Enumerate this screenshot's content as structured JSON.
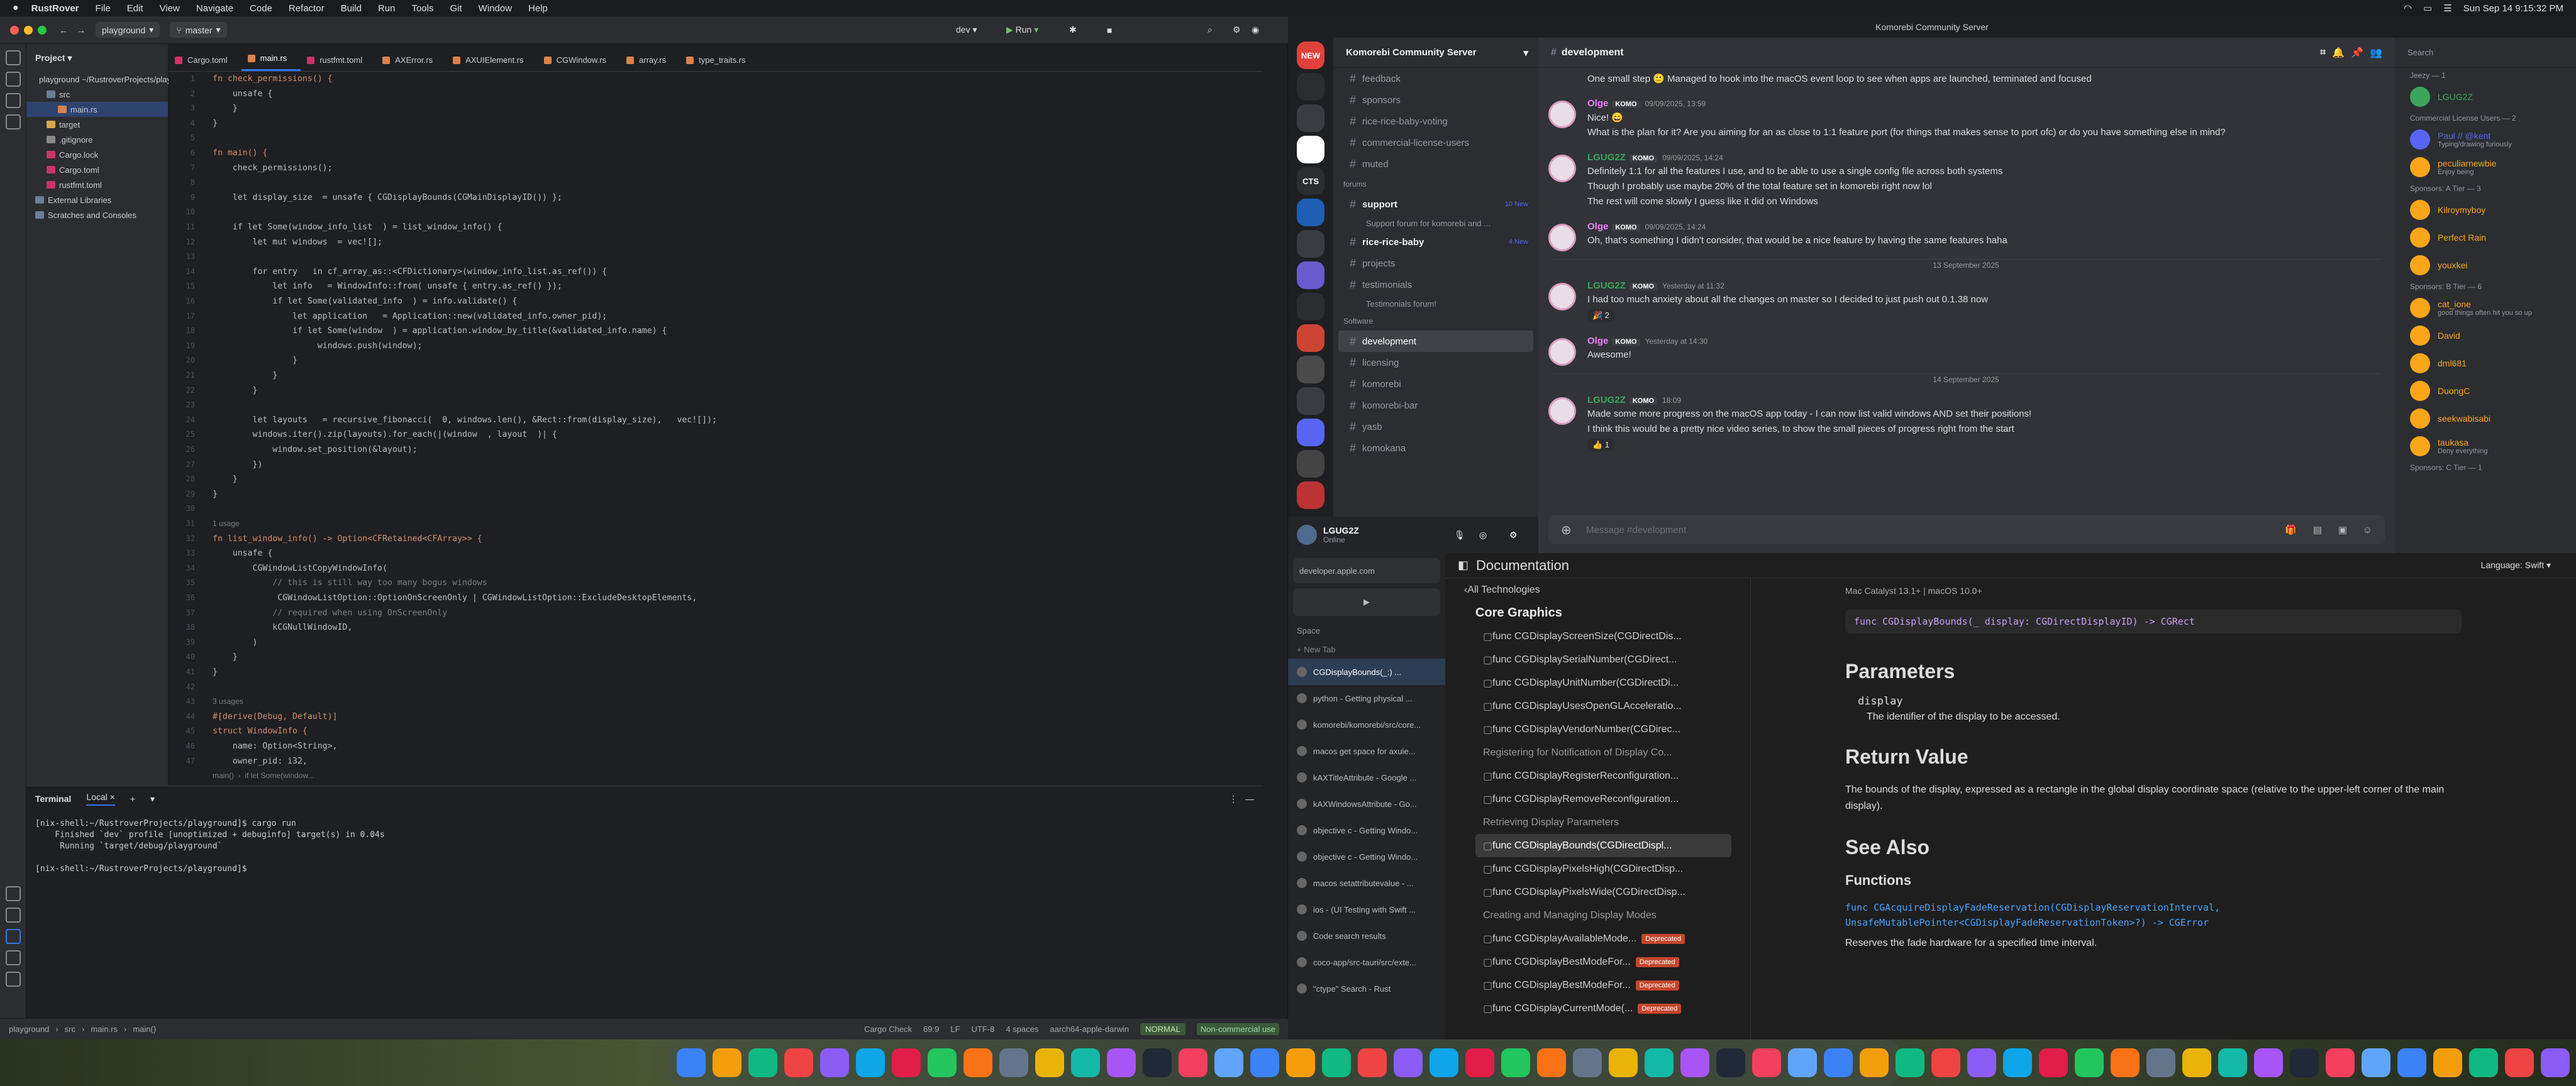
{
  "menubar": {
    "apple": "",
    "app_name": "RustRover",
    "items": [
      "File",
      "Edit",
      "View",
      "Navigate",
      "Code",
      "Refactor",
      "Build",
      "Run",
      "Tools",
      "Git",
      "Window",
      "Help"
    ],
    "clock": "Sun Sep 14  9:15:32 PM"
  },
  "ide": {
    "project_chip": "playground",
    "branch_chip": "master",
    "run_config": "dev",
    "run_label": "Run",
    "project_title": "Project",
    "tree": [
      {
        "label": "playground ~/RustroverProjects/playground",
        "indent": 0,
        "color": "#6b7d9a"
      },
      {
        "label": "src",
        "indent": 1,
        "color": "#6b7d9a"
      },
      {
        "label": "main.rs",
        "indent": 2,
        "color": "#d9824b",
        "selected": true
      },
      {
        "label": "target",
        "indent": 1,
        "color": "#d9a64b"
      },
      {
        "label": ".gitignore",
        "indent": 1,
        "color": "#888"
      },
      {
        "label": "Cargo.lock",
        "indent": 1,
        "color": "#c36"
      },
      {
        "label": "Cargo.toml",
        "indent": 1,
        "color": "#c36"
      },
      {
        "label": "rustfmt.toml",
        "indent": 1,
        "color": "#c36"
      },
      {
        "label": "External Libraries",
        "indent": 0,
        "color": "#6b7d9a"
      },
      {
        "label": "Scratches and Consoles",
        "indent": 0,
        "color": "#6b7d9a"
      }
    ],
    "tabs": [
      {
        "label": "Cargo.toml",
        "color": "#c36"
      },
      {
        "label": "main.rs",
        "color": "#d9824b",
        "active": true
      },
      {
        "label": "rustfmt.toml",
        "color": "#c36"
      },
      {
        "label": "AXError.rs",
        "color": "#d9824b"
      },
      {
        "label": "AXUIElement.rs",
        "color": "#d9824b"
      },
      {
        "label": "CGWindow.rs",
        "color": "#d9824b"
      },
      {
        "label": "array.rs",
        "color": "#d9824b"
      },
      {
        "label": "type_traits.rs",
        "color": "#d9824b"
      }
    ],
    "code_lines": [
      "fn check_permissions() {",
      "    unsafe {",
      "    }",
      "}",
      "",
      "fn main() {",
      "    check_permissions();",
      "",
      "    let display_size  = unsafe { CGDisplayBounds(CGMainDisplayID()) };",
      "",
      "    if let Some(window_info_list  ) = list_window_info() {",
      "        let mut windows  = vec![];",
      "",
      "        for entry   in cf_array_as::<CFDictionary>(window_info_list.as_ref()) {",
      "            let info   = WindowInfo::from( unsafe { entry.as_ref() });",
      "            if let Some(validated_info  ) = info.validate() {",
      "                let application   = Application::new(validated_info.owner_pid);",
      "                if let Some(window  ) = application.window_by_title(&validated_info.name) {",
      "                     windows.push(window);",
      "                }",
      "            }",
      "        }",
      "",
      "        let layouts   = recursive_fibonacci(  0, windows.len(), &Rect::from(display_size),   vec![]);",
      "        windows.iter().zip(layouts).for_each(|(window  , layout  )| {",
      "            window.set_position(&layout);",
      "        })",
      "    }",
      "}",
      "",
      "1 usage",
      "fn list_window_info() -> Option<CFRetained<CFArray>> {",
      "    unsafe {",
      "        CGWindowListCopyWindowInfo(",
      "            // this is still way too many bogus windows",
      "             CGWindowListOption::OptionOnScreenOnly | CGWindowListOption::ExcludeDesktopElements,",
      "            // required when using OnScreenOnly",
      "            kCGNullWindowID,",
      "        )",
      "    }",
      "}",
      "",
      "3 usages",
      "#[derive(Debug, Default)]",
      "struct WindowInfo {",
      "    name: Option<String>,",
      "    owner_pid: i32,",
      "main()  ›  if let Some(window..."
    ],
    "terminal": {
      "tab_terminal": "Terminal",
      "tab_local": "Local",
      "lines": [
        "[nix-shell:~/RustroverProjects/playground]$ cargo run",
        "    Finished `dev` profile [unoptimized + debuginfo] target(s) in 0.04s",
        "     Running `target/debug/playground`",
        "",
        "[nix-shell:~/RustroverProjects/playground]$ "
      ]
    },
    "status": {
      "crumbs": [
        "playground",
        "src",
        "main.rs",
        "main()"
      ],
      "right": [
        "Cargo Check",
        "69:9",
        "LF",
        "UTF-8",
        "4 spaces",
        "aarch64-apple-darwin"
      ],
      "mode": "NORMAL",
      "license": "Non-commercial use"
    }
  },
  "discord": {
    "window_title": "Komorebi Community Server",
    "server_name": "Komorebi Community Server",
    "servers": [
      "NEW",
      "",
      "",
      "",
      "CTS",
      "",
      "",
      "",
      "",
      "",
      "",
      "",
      "",
      "",
      ""
    ],
    "channels": [
      {
        "type": "ch",
        "label": "feedback"
      },
      {
        "type": "ch",
        "label": "sponsors"
      },
      {
        "type": "ch",
        "label": "rice-rice-baby-voting"
      },
      {
        "type": "ch",
        "label": "commercial-license-users"
      },
      {
        "type": "ch",
        "label": "muted"
      },
      {
        "type": "cat",
        "label": "forums"
      },
      {
        "type": "ch",
        "label": "support",
        "badge": "10 New",
        "bold": true
      },
      {
        "type": "sub",
        "label": "Support forum for komorebi and ..."
      },
      {
        "type": "ch",
        "label": "rice-rice-baby",
        "badge": "4 New",
        "bold": true
      },
      {
        "type": "ch",
        "label": "projects"
      },
      {
        "type": "ch",
        "label": "testimonials"
      },
      {
        "type": "sub",
        "label": "Testimonials forum!"
      },
      {
        "type": "cat",
        "label": "Software"
      },
      {
        "type": "ch",
        "label": "development",
        "active": true
      },
      {
        "type": "ch",
        "label": "licensing"
      },
      {
        "type": "ch",
        "label": "komorebi"
      },
      {
        "type": "ch",
        "label": "komorebi-bar"
      },
      {
        "type": "ch",
        "label": "yasb"
      },
      {
        "type": "ch",
        "label": "komokana"
      }
    ],
    "user": {
      "name": "LGUG2Z",
      "status": "Online"
    },
    "channel_title": "development",
    "messages": [
      {
        "kind": "text",
        "text": "One small step 🙂 Managed to hook into the macOS event loop to see when apps are launched, terminated and focused"
      },
      {
        "kind": "head",
        "author": "Olge",
        "color": "#f47fff",
        "time": "09/09/2025, 13:59"
      },
      {
        "kind": "text",
        "text": "Nice! 😄"
      },
      {
        "kind": "text",
        "text": "What is the plan for it? Are you aiming for an as close to 1:1 feature port (for things that makes sense to port ofc) or do you have something else in mind?"
      },
      {
        "kind": "head",
        "author": "LGUG2Z",
        "color": "#3ba55c",
        "time": "09/09/2025, 14:24"
      },
      {
        "kind": "text",
        "text": "Definitely 1:1 for all the features I use, and to be able to use a single config file across both systems"
      },
      {
        "kind": "text",
        "text": "Though I probably use maybe 20% of the total feature set in komorebi right now lol"
      },
      {
        "kind": "text",
        "text": "The rest will come slowly I guess like it did on Windows"
      },
      {
        "kind": "head",
        "author": "Olge",
        "color": "#f47fff",
        "time": "09/09/2025, 14:24"
      },
      {
        "kind": "text",
        "text": "Oh, that's something I didn't consider, that would be a nice feature by having the same features haha"
      },
      {
        "kind": "date",
        "text": "13 September 2025"
      },
      {
        "kind": "head",
        "author": "LGUG2Z",
        "color": "#3ba55c",
        "time": "Yesterday at 11:32"
      },
      {
        "kind": "text",
        "text": "I had too much anxiety about all the changes on  master  so I decided to just push out 0.1.38 now"
      },
      {
        "kind": "react",
        "text": "🎉 2"
      },
      {
        "kind": "head",
        "author": "Olge",
        "color": "#f47fff",
        "time": "Yesterday at 14:30"
      },
      {
        "kind": "text",
        "text": "Awesome!"
      },
      {
        "kind": "date",
        "text": "14 September 2025"
      },
      {
        "kind": "head",
        "author": "LGUG2Z",
        "color": "#3ba55c",
        "time": "18:09"
      },
      {
        "kind": "text",
        "text": "Made some more progress on the macOS app today - I can now list valid windows AND set their positions!"
      },
      {
        "kind": "text",
        "text": "I think this would be a pretty nice video series, to show the small pieces of progress right from the start"
      },
      {
        "kind": "react",
        "text": "👍 1"
      }
    ],
    "input_placeholder": "Message #development",
    "members_search": "Search",
    "members": [
      {
        "kind": "cat",
        "text": "Jeezy — 1"
      },
      {
        "kind": "mem",
        "name": "LGUG2Z",
        "color": "#3ba55c"
      },
      {
        "kind": "cat",
        "text": "Commercial License Users — 2"
      },
      {
        "kind": "mem",
        "name": "Paul // @kent",
        "sub": "Typing/drawing furiously",
        "color": "#5865f2"
      },
      {
        "kind": "mem",
        "name": "peculiarnewbie",
        "sub": "Enjoy being",
        "color": "#faa61a"
      },
      {
        "kind": "cat",
        "text": "Sponsors: A Tier — 3"
      },
      {
        "kind": "mem",
        "name": "Kilroymyboy",
        "color": "#faa61a"
      },
      {
        "kind": "mem",
        "name": "Perfect Rain",
        "color": "#faa61a"
      },
      {
        "kind": "mem",
        "name": "youxkei",
        "color": "#faa61a"
      },
      {
        "kind": "cat",
        "text": "Sponsors: B Tier — 6"
      },
      {
        "kind": "mem",
        "name": "cat_ione",
        "sub": "good things often hit you so up",
        "color": "#faa61a"
      },
      {
        "kind": "mem",
        "name": "David",
        "color": "#faa61a"
      },
      {
        "kind": "mem",
        "name": "dml681",
        "color": "#faa61a"
      },
      {
        "kind": "mem",
        "name": "DuongC",
        "color": "#faa61a"
      },
      {
        "kind": "mem",
        "name": "seekwabisabi",
        "color": "#faa61a"
      },
      {
        "kind": "mem",
        "name": "taukasa",
        "sub": "Deny everything",
        "color": "#faa61a"
      },
      {
        "kind": "cat",
        "text": "Sponsors: C Tier — 1"
      }
    ]
  },
  "browser": {
    "url": "developer.apple.com",
    "space": "Space",
    "new_tab": "+ New Tab",
    "tabs": [
      {
        "label": "CGDisplayBounds(_:) ...",
        "selected": true
      },
      {
        "label": "python - Getting physical ..."
      },
      {
        "label": "komorebi/komorebi/src/core..."
      },
      {
        "label": "macos get space for axuie..."
      },
      {
        "label": "kAXTitleAttribute - Google ..."
      },
      {
        "label": "kAXWindowsAttribute - Go..."
      },
      {
        "label": "objective c - Getting Windo..."
      },
      {
        "label": "objective c - Getting Windo..."
      },
      {
        "label": "macos setattributevalue - ..."
      },
      {
        "label": "ios - (UI Testing with Swift ..."
      },
      {
        "label": "Code search results"
      },
      {
        "label": "coco-app/src-tauri/src/exte..."
      },
      {
        "label": "\"ctype\" Search - Rust"
      }
    ],
    "doc_header": "Documentation",
    "language": "Language: Swift",
    "nav": [
      {
        "kind": "item",
        "label": "All Technologies",
        "top": true
      },
      {
        "kind": "title",
        "label": "Core Graphics"
      },
      {
        "kind": "item",
        "label": "func CGDisplayScreenSize(CGDirectDis..."
      },
      {
        "kind": "item",
        "label": "func CGDisplaySerialNumber(CGDirect..."
      },
      {
        "kind": "item",
        "label": "func CGDisplayUnitNumber(CGDirectDi..."
      },
      {
        "kind": "item",
        "label": "func CGDisplayUsesOpenGLAcceleratio..."
      },
      {
        "kind": "item",
        "label": "func CGDisplayVendorNumber(CGDirec..."
      },
      {
        "kind": "sec",
        "label": "Registering for Notification of Display Co..."
      },
      {
        "kind": "item",
        "label": "func CGDisplayRegisterReconfiguration..."
      },
      {
        "kind": "item",
        "label": "func CGDisplayRemoveReconfiguration..."
      },
      {
        "kind": "sec",
        "label": "Retrieving Display Parameters"
      },
      {
        "kind": "item",
        "label": "func CGDisplayBounds(CGDirectDispl...",
        "selected": true
      },
      {
        "kind": "item",
        "label": "func CGDisplayPixelsHigh(CGDirectDisp..."
      },
      {
        "kind": "item",
        "label": "func CGDisplayPixelsWide(CGDirectDisp..."
      },
      {
        "kind": "sec",
        "label": "Creating and Managing Display Modes"
      },
      {
        "kind": "item",
        "label": "func CGDisplayAvailableMode...",
        "dep": "Deprecated"
      },
      {
        "kind": "item",
        "label": "func CGDisplayBestModeFor...",
        "dep": "Deprecated"
      },
      {
        "kind": "item",
        "label": "func CGDisplayBestModeFor...",
        "dep": "Deprecated"
      },
      {
        "kind": "item",
        "label": "func CGDisplayCurrentMode(...",
        "dep": "Deprecated"
      }
    ],
    "doc": {
      "platforms": "Mac Catalyst 13.1+  |  macOS 10.0+",
      "signature": "func CGDisplayBounds(_ display: CGDirectDisplayID) -> CGRect",
      "h_parameters": "Parameters",
      "param_name": "display",
      "param_desc": "The identifier of the display to be accessed.",
      "h_return": "Return Value",
      "return_desc": "The bounds of the display, expressed as a rectangle in the global display coordinate space (relative to the upper-left corner of the main display).",
      "h_see_also": "See Also",
      "h_functions": "Functions",
      "func_sig": "func CGAcquireDisplayFadeReservation(CGDisplayReservationInterval, UnsafeMutablePointer<CGDisplayFadeReservationToken>?) -> CGError",
      "func_desc": "Reserves the fade hardware for a specified time interval."
    }
  },
  "dock_count": 56
}
